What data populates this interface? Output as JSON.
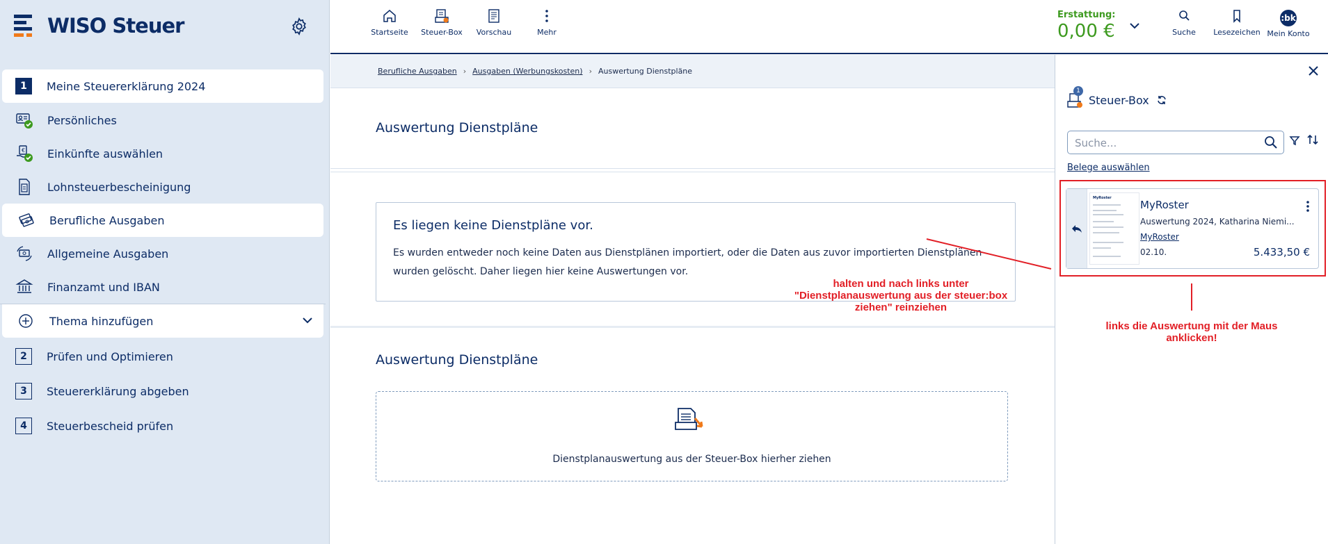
{
  "app": {
    "logo_text": "WISO Steuer"
  },
  "sidebar": {
    "items": [
      {
        "label": "Meine Steuererklärung 2024",
        "num": "1"
      },
      {
        "label": "Persönliches"
      },
      {
        "label": "Einkünfte auswählen"
      },
      {
        "label": "Lohnsteuerbescheinigung"
      },
      {
        "label": "Berufliche Ausgaben"
      },
      {
        "label": "Allgemeine Ausgaben"
      },
      {
        "label": "Finanzamt und IBAN"
      },
      {
        "label": "Thema hinzufügen"
      },
      {
        "label": "Prüfen und Optimieren",
        "num": "2"
      },
      {
        "label": "Steuererklärung abgeben",
        "num": "3"
      },
      {
        "label": "Steuerbescheid prüfen",
        "num": "4"
      }
    ]
  },
  "topbar": {
    "startseite": "Startseite",
    "steuerbox": "Steuer-Box",
    "vorschau": "Vorschau",
    "mehr": "Mehr",
    "erstattung_label": "Erstattung:",
    "erstattung_value": "0,00 €",
    "suche": "Suche",
    "lesezeichen": "Lesezeichen",
    "konto": "Mein Konto",
    "avatar_initials": ":bk"
  },
  "breadcrumb": {
    "items": [
      "Berufliche Ausgaben",
      "Ausgaben (Werbungskosten)",
      "Auswertung Dienstpläne"
    ]
  },
  "main": {
    "section1_title": "Auswertung Dienstpläne",
    "info_title": "Es liegen keine Dienstpläne vor.",
    "info_text": "Es wurden entweder noch keine Daten aus Dienstplänen importiert, oder die Daten aus zuvor importierten Dienstplänen wurden gelöscht. Daher liegen hier keine Auswertungen vor.",
    "section2_title": "Auswertung Dienstpläne",
    "dropzone_text": "Dienstplanauswertung aus der Steuer-Box hierher ziehen"
  },
  "steuerbox_panel": {
    "title": "Steuer-Box",
    "badge": "1",
    "search_placeholder": "Suche...",
    "select_link": "Belege auswählen",
    "card": {
      "title": "MyRoster",
      "subtitle": "Auswertung 2024, Katharina Niemi...",
      "link": "MyRoster",
      "date": "02.10.",
      "amount": "5.433,50 €",
      "thumb_brand": "MyRoster"
    }
  },
  "annotations": {
    "drag_hint": "halten und nach links unter \"Dienstplanauswertung aus der steuer:box ziehen\" reinziehen",
    "click_hint": "links die Auswertung mit der Maus anklicken!"
  },
  "colors": {
    "brand_navy": "#0c2c66",
    "accent_orange": "#f07a1a",
    "success_green": "#3d9a1f",
    "annotation_red": "#e21f26"
  }
}
